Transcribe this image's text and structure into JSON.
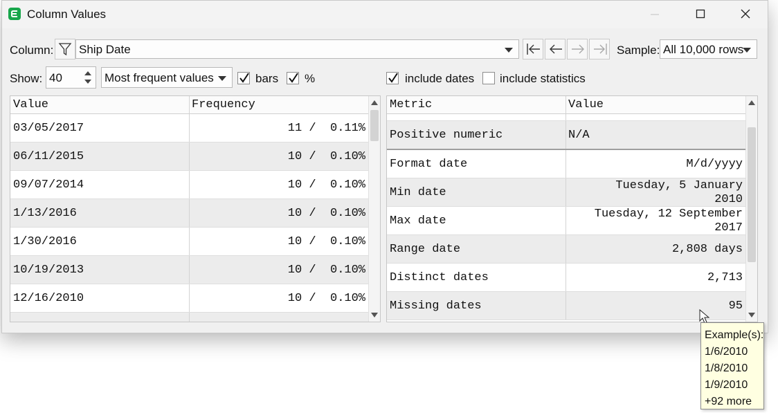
{
  "window": {
    "title": "Column Values"
  },
  "toolbar": {
    "column_label": "Column:",
    "column_value": "Ship Date",
    "sample_label": "Sample:",
    "sample_value": "All 10,000 rows"
  },
  "options": {
    "show_label": "Show:",
    "show_value": "40",
    "mode_value": "Most frequent values",
    "bars_label": "bars",
    "bars_checked": true,
    "percent_label": "%",
    "percent_checked": true,
    "include_dates_label": "include dates",
    "include_dates_checked": true,
    "include_statistics_label": "include statistics",
    "include_statistics_checked": false
  },
  "values_table": {
    "headers": [
      "Value",
      "Frequency"
    ],
    "rows": [
      {
        "value": "03/05/2017",
        "frequency": "11 /  0.11%"
      },
      {
        "value": "06/11/2015",
        "frequency": "10 /  0.10%"
      },
      {
        "value": "09/07/2014",
        "frequency": "10 /  0.10%"
      },
      {
        "value": "1/13/2016",
        "frequency": "10 /  0.10%"
      },
      {
        "value": "1/30/2016",
        "frequency": "10 /  0.10%"
      },
      {
        "value": "10/19/2013",
        "frequency": "10 /  0.10%"
      },
      {
        "value": "12/16/2010",
        "frequency": "10 /  0.10%"
      }
    ]
  },
  "metrics_table": {
    "headers": [
      "Metric",
      "Value"
    ],
    "rows": [
      {
        "metric": "Positive numeric",
        "value": "N/A"
      },
      {
        "metric": "Format date",
        "value": "M/d/yyyy"
      },
      {
        "metric": "Min date",
        "value_line1": "Tuesday, 5 January",
        "value_line2": "2010"
      },
      {
        "metric": "Max date",
        "value_line1": "Tuesday, 12 September",
        "value_line2": "2017"
      },
      {
        "metric": "Range date",
        "value": "2,808 days"
      },
      {
        "metric": "Distinct dates",
        "value": "2,713"
      },
      {
        "metric": "Missing dates",
        "value": "95"
      }
    ]
  },
  "tooltip": {
    "lines": [
      "Example(s):",
      "1/6/2010",
      "1/8/2010",
      "1/9/2010",
      "+92 more"
    ]
  }
}
